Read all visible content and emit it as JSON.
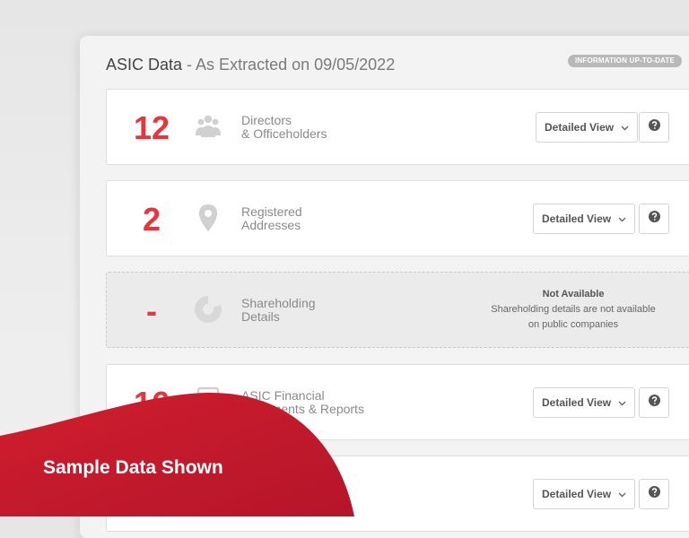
{
  "header": {
    "title_main": "ASIC Data",
    "title_sub": " - As Extracted on 09/05/2022",
    "status_badge": "INFORMATION UP-TO-DATE"
  },
  "cards": [
    {
      "count": "12",
      "icon": "people-group-icon",
      "label_line1": "Directors",
      "label_line2": "& Officeholders",
      "view_label": "Detailed View"
    },
    {
      "count": "2",
      "icon": "map-pin-icon",
      "label_line1": "Registered",
      "label_line2": "Addresses",
      "view_label": "Detailed View"
    },
    {
      "count": "-",
      "icon": "pie-chart-icon",
      "label_line1": "Shareholding",
      "label_line2": "Details",
      "unavailable_title": "Not Available",
      "unavailable_line1": "Shareholding details are not available",
      "unavailable_line2": "on public companies"
    },
    {
      "count": "16",
      "icon": "document-icon",
      "label_line1": "ASIC Financial",
      "label_line2": "Statements & Reports",
      "view_label": "Detailed View"
    },
    {
      "view_label": "Detailed View"
    }
  ],
  "banner": {
    "text": "Sample Data Shown"
  },
  "colors": {
    "accent_red": "#e8343a",
    "banner_red": "#c8192b"
  }
}
